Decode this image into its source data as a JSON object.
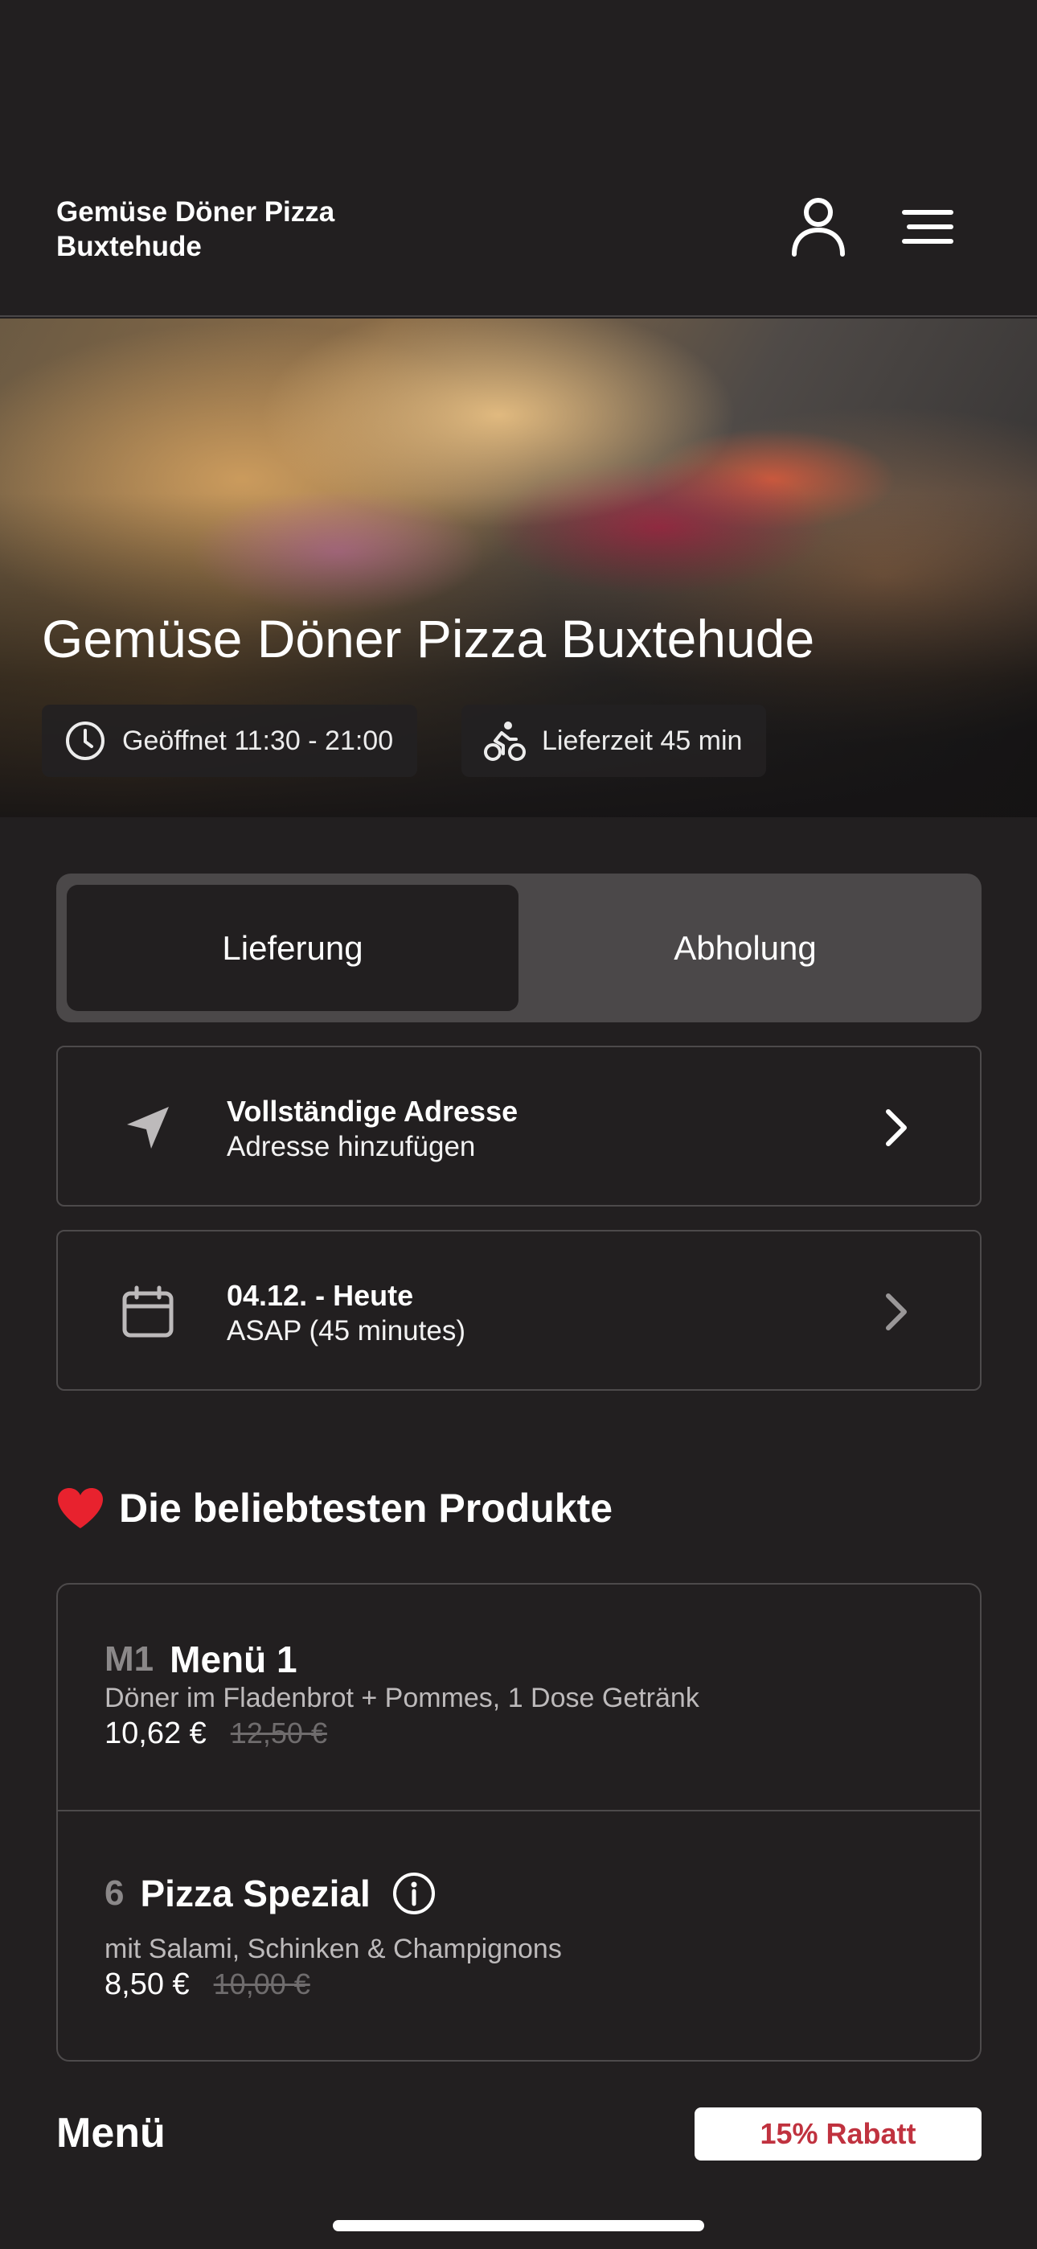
{
  "header": {
    "brand_line1": "Gemüse Döner Pizza",
    "brand_line2": "Buxtehude",
    "user_icon": "user-icon",
    "menu_icon": "hamburger-menu-icon"
  },
  "hero": {
    "title": "Gemüse Döner Pizza Buxtehude",
    "opening_hours": "Geöffnet 11:30 - 21:00",
    "delivery_time": "Lieferzeit 45 min"
  },
  "mode_toggle": {
    "selected": "Lieferung",
    "options": [
      "Lieferung",
      "Abholung"
    ]
  },
  "address": {
    "title": "Vollständige Adresse",
    "subtitle": "Adresse hinzufügen"
  },
  "schedule": {
    "title": "04.12. - Heute",
    "subtitle": "ASAP (45 minutes)"
  },
  "popular": {
    "heading": "Die beliebtesten Produkte",
    "items": [
      {
        "number": "M1",
        "name": "Menü 1",
        "description": "Döner im Fladenbrot + Pommes, 1 Dose Getränk",
        "price": "10,62 €",
        "old_price": "12,50 €"
      },
      {
        "number": "6",
        "name": "Pizza Spezial",
        "description": "mit Salami, Schinken & Champignons",
        "price": "8,50 €",
        "old_price": "10,00 €"
      }
    ]
  },
  "menu": {
    "heading": "Menü",
    "discount_badge": "15% Rabatt"
  },
  "colors": {
    "background": "#221f20",
    "discount_text": "#c0323f",
    "toggle_track": "#4b4849"
  }
}
